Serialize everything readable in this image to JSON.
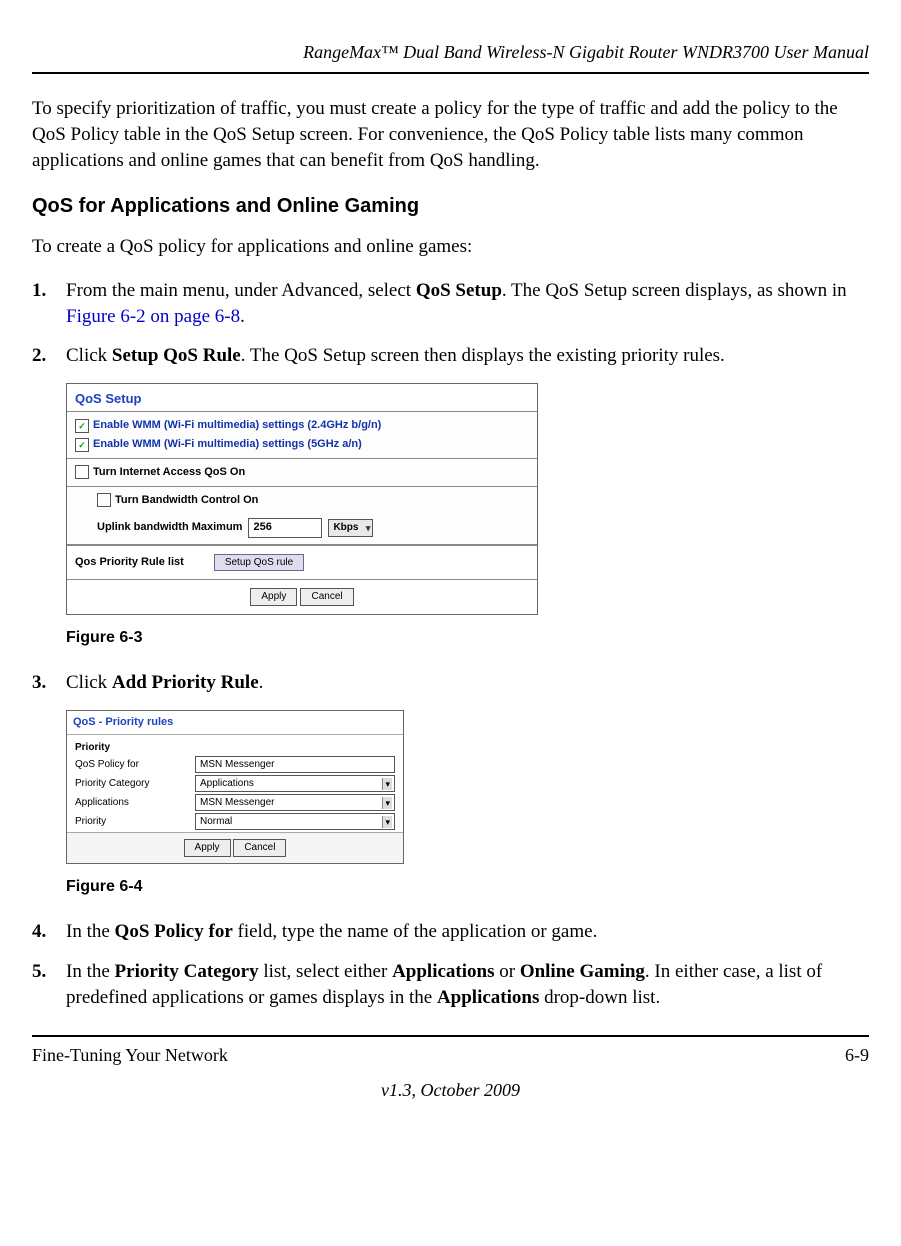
{
  "header": {
    "title": "RangeMax™ Dual Band Wireless-N Gigabit Router WNDR3700 User Manual"
  },
  "intro_para": "To specify prioritization of traffic, you must create a policy for the type of traffic and add the policy to the QoS Policy table in the QoS Setup screen. For convenience, the QoS Policy table lists many common applications and online games that can benefit from QoS handling.",
  "subheading": "QoS for Applications and Online Gaming",
  "lead_sentence": "To create a QoS policy for applications and online games:",
  "steps": {
    "s1_a": "From the main menu, under Advanced, select ",
    "s1_bold": "QoS Setup",
    "s1_b": ". The QoS Setup screen displays, as shown in ",
    "s1_xref": "Figure 6-2 on page 6-8",
    "s1_c": ".",
    "s2_a": "Click ",
    "s2_bold": "Setup QoS Rule",
    "s2_b": ". The QoS Setup screen then displays the existing priority rules.",
    "s3_a": "Click ",
    "s3_bold": "Add Priority Rule",
    "s3_b": ".",
    "s4_a": "In the ",
    "s4_bold": "QoS Policy for",
    "s4_b": " field, type the name of the application or game.",
    "s5_a": "In the ",
    "s5_bold1": "Priority Category",
    "s5_b": " list, select either ",
    "s5_bold2": "Applications",
    "s5_c": " or ",
    "s5_bold3": "Online Gaming",
    "s5_d": ". In either case, a list of predefined applications or games displays in the ",
    "s5_bold4": "Applications",
    "s5_e": " drop-down list."
  },
  "qos_setup": {
    "title": "QoS Setup",
    "wmm24": "Enable WMM (Wi-Fi multimedia) settings (2.4GHz b/g/n)",
    "wmm5": "Enable WMM (Wi-Fi multimedia) settings (5GHz a/n)",
    "internet_qos": "Turn Internet Access QoS On",
    "bw_control": "Turn Bandwidth Control On",
    "uplink_label": "Uplink bandwidth   Maximum",
    "uplink_value": "256",
    "uplink_unit": "Kbps",
    "rule_list_label": "Qos Priority Rule list",
    "setup_rule_btn": "Setup QoS rule",
    "apply": "Apply",
    "cancel": "Cancel"
  },
  "fig_63": "Figure 6-3",
  "prio": {
    "title": "QoS - Priority rules",
    "heading": "Priority",
    "policy_for_label": "QoS Policy for",
    "policy_for_value": "MSN Messenger",
    "category_label": "Priority Category",
    "category_value": "Applications",
    "applications_label": "Applications",
    "applications_value": "MSN Messenger",
    "priority_label": "Priority",
    "priority_value": "Normal",
    "apply": "Apply",
    "cancel": "Cancel"
  },
  "fig_64": "Figure 6-4",
  "footer": {
    "left": "Fine-Tuning Your Network",
    "right": "6-9",
    "version": "v1.3, October 2009"
  }
}
